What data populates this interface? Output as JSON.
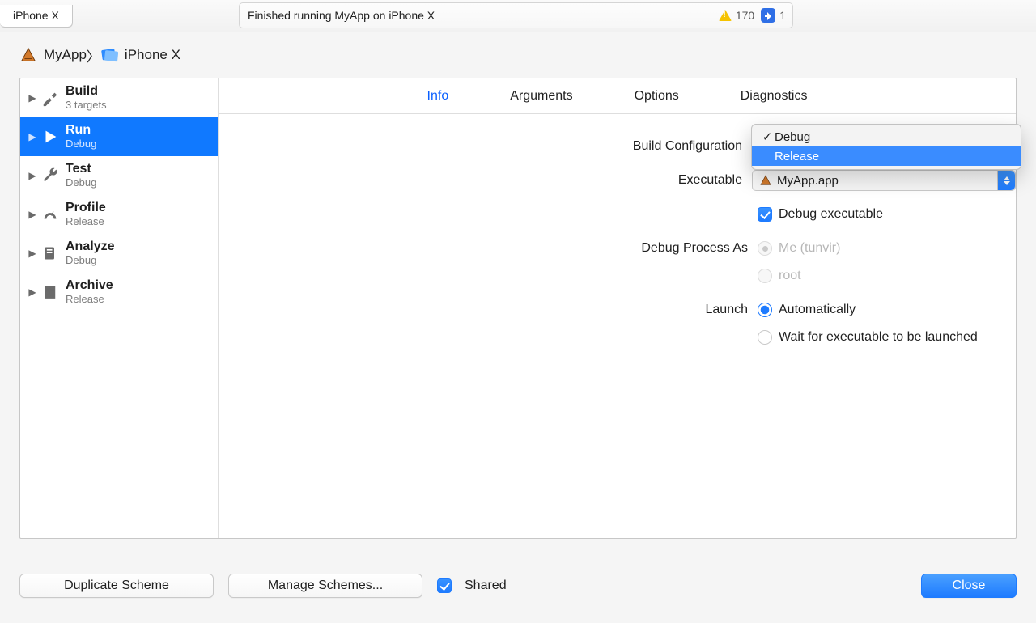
{
  "topbar": {
    "tab_label": "iPhone X",
    "status_text": "Finished running MyApp on iPhone X",
    "warning_count": "170",
    "analyze_count": "1"
  },
  "breadcrumb": {
    "app": "MyApp",
    "device": "iPhone X"
  },
  "sidebar": {
    "items": [
      {
        "title": "Build",
        "sub": "3 targets"
      },
      {
        "title": "Run",
        "sub": "Debug"
      },
      {
        "title": "Test",
        "sub": "Debug"
      },
      {
        "title": "Profile",
        "sub": "Release"
      },
      {
        "title": "Analyze",
        "sub": "Debug"
      },
      {
        "title": "Archive",
        "sub": "Release"
      }
    ]
  },
  "tabs": {
    "info": "Info",
    "arguments": "Arguments",
    "options": "Options",
    "diagnostics": "Diagnostics"
  },
  "form": {
    "build_configuration_label": "Build Configuration",
    "build_configuration_value": "Debug",
    "build_configuration_options": {
      "debug": "Debug",
      "release": "Release"
    },
    "executable_label": "Executable",
    "executable_value": "MyApp.app",
    "debug_exe_label": "Debug executable",
    "debug_process_as_label": "Debug Process As",
    "me_label": "Me (tunvir)",
    "root_label": "root",
    "launch_label": "Launch",
    "auto_label": "Automatically",
    "wait_label": "Wait for executable to be launched"
  },
  "footer": {
    "duplicate": "Duplicate Scheme",
    "manage": "Manage Schemes...",
    "shared": "Shared",
    "close": "Close"
  }
}
